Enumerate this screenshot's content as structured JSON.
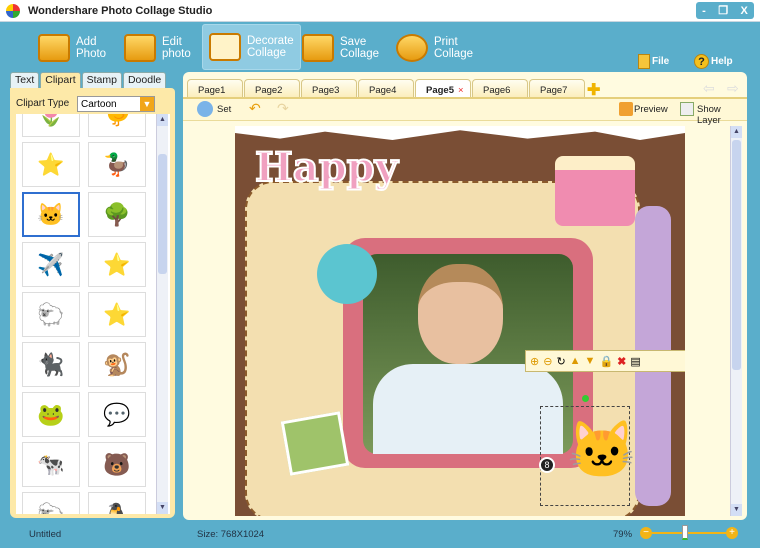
{
  "window": {
    "title": "Wondershare Photo Collage Studio",
    "controls": [
      "-",
      "❐",
      "X"
    ]
  },
  "toolbar": [
    {
      "label1": "Add",
      "label2": "Photo"
    },
    {
      "label1": "Edit",
      "label2": "photo"
    },
    {
      "label1": "Decorate",
      "label2": "Collage"
    },
    {
      "label1": "Save",
      "label2": "Collage"
    },
    {
      "label1": "Print",
      "label2": "Collage"
    }
  ],
  "menu": {
    "file": "File",
    "help": "Help"
  },
  "left_panel": {
    "tabs": [
      "Text",
      "Clipart",
      "Stamp",
      "Doodle"
    ],
    "active_tab": "Clipart",
    "clipart_type_label": "Clipart Type",
    "clipart_type_value": "Cartoon",
    "items": [
      "🌷",
      "🐤",
      "⭐",
      "🦆",
      "🐱",
      "🌳",
      "✈️",
      "⭐",
      "🐑",
      "⭐",
      "🐈‍⬛",
      "🐒",
      "🐸",
      "💬",
      "🐄",
      "🐻",
      "🐑",
      "🐧"
    ]
  },
  "page_tabs": [
    "Page1",
    "Page2",
    "Page3",
    "Page4",
    "Page5",
    "Page6",
    "Page7"
  ],
  "active_page": "Page5",
  "edit_toolbar": {
    "set": "Set",
    "preview": "Preview",
    "show_layer": "Show Layer"
  },
  "canvas": {
    "happy_text": "Happy",
    "badge": "8"
  },
  "status": {
    "filename": "Untitled",
    "size": "Size:  768X1024",
    "zoom": "79%",
    "zoom_fraction": 0.45
  }
}
